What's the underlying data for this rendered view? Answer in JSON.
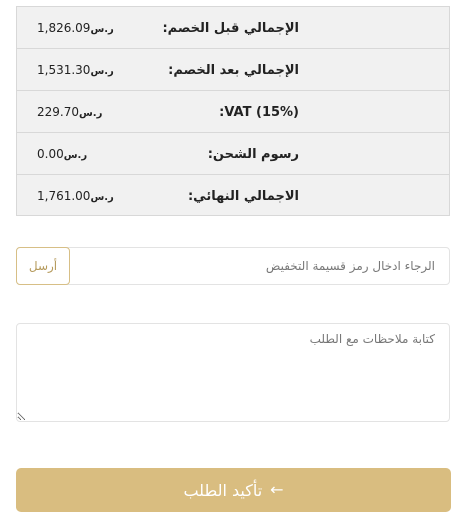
{
  "currency_symbol": "ر.س",
  "summary": {
    "rows": [
      {
        "label": "الإجمالي قبل الخصم:",
        "value": "1,826.09"
      },
      {
        "label": "الإجمالي بعد الخصم:",
        "value": "1,531.30"
      },
      {
        "label": "VAT (15%):",
        "value": "229.70"
      },
      {
        "label": "رسوم الشحن:",
        "value": "0.00"
      },
      {
        "label": "الاجمالي النهائي:",
        "value": "1,761.00"
      }
    ]
  },
  "coupon": {
    "placeholder": "الرجاء ادخال رمز قسيمة التخفيض",
    "button_label": "أرسل"
  },
  "notes": {
    "placeholder": "كتابة ملاحظات مع الطلب"
  },
  "confirm": {
    "label": "تأكيد الطلب",
    "icon": "arrow-left-icon"
  },
  "colors": {
    "accent": "#d9bd80",
    "accent_text": "#b59a5c",
    "summary_bg": "#f1f1f1"
  }
}
